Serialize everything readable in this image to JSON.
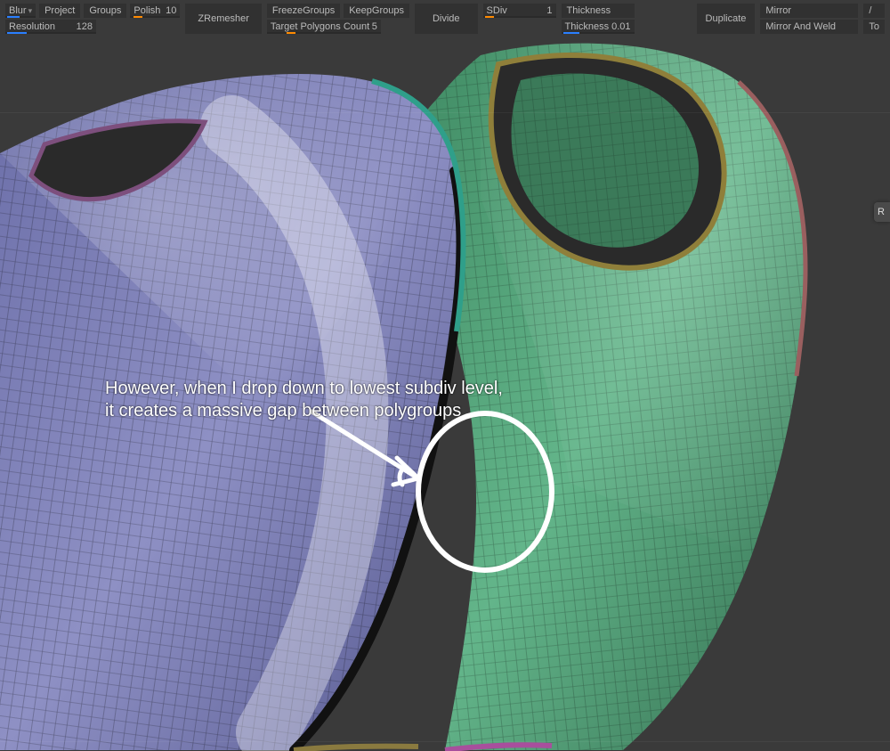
{
  "toolbar": {
    "blur": {
      "label": "Blur"
    },
    "project": "Project",
    "groups": "Groups",
    "polish": {
      "label": "Polish",
      "value": "10"
    },
    "resolution": {
      "label": "Resolution",
      "value": "128"
    },
    "zremesher": "ZRemesher",
    "freezeGroups": "FreezeGroups",
    "keepGroups": "KeepGroups",
    "targetPolys": {
      "label": "Target Polygons Count",
      "value": "5"
    },
    "divide": "Divide",
    "sdiv": {
      "label": "SDiv",
      "value": "1"
    },
    "thickness_label": "Thickness",
    "thickness": {
      "label": "Thickness",
      "value": "0.01"
    },
    "duplicate": "Duplicate",
    "mirror": "Mirror",
    "mirrorWeld": "Mirror And Weld",
    "a_partial": "/",
    "to_partial": "To"
  },
  "annot": {
    "line1": "However, when I drop down to lowest subdiv level,",
    "line2": "it creates a massive gap between polygroups"
  },
  "side": {
    "r_partial": "R"
  }
}
